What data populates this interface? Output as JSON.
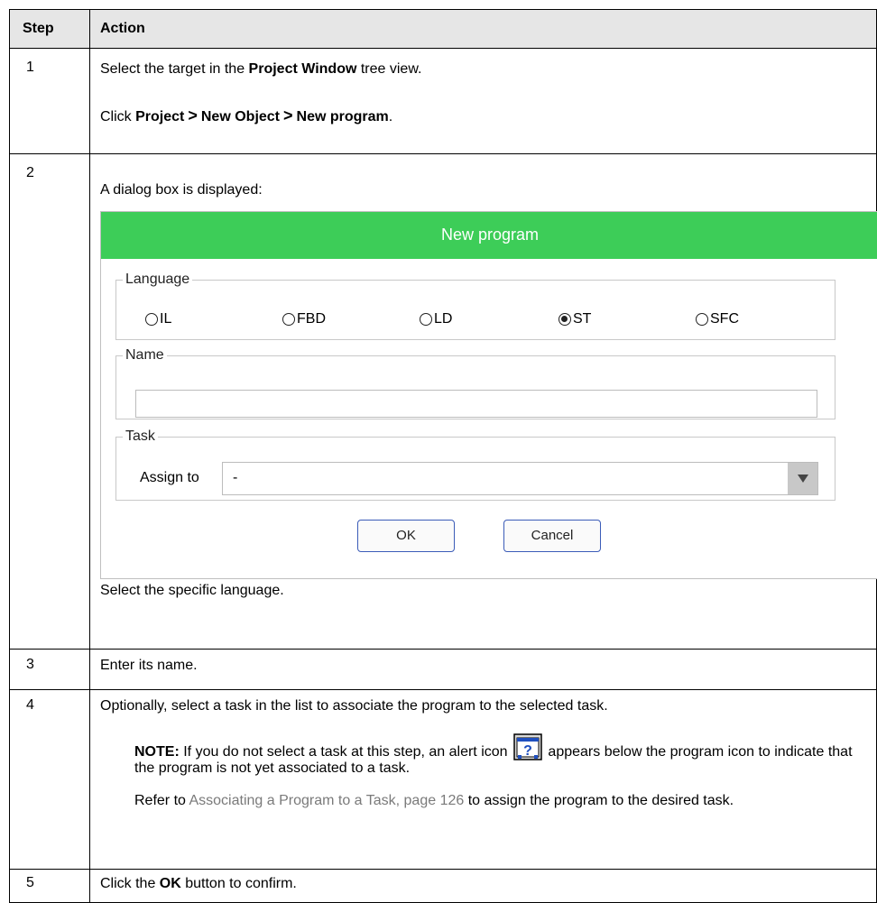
{
  "table": {
    "headers": {
      "step": "Step",
      "action": "Action"
    },
    "step1": {
      "num": "1",
      "line1_pre": "Select the target in the ",
      "line1_bold": "Project Window",
      "line1_post": " tree view.",
      "line2_pre": "Click ",
      "menu1": "Project",
      "menu2": "New Object",
      "menu3": "New program",
      "separator": ">",
      "line2_post": "."
    },
    "step2": {
      "num": "2",
      "intro": "A dialog box is displayed:",
      "outro": "Select the specific language."
    },
    "step3": {
      "num": "3",
      "text": "Enter its name."
    },
    "step4": {
      "num": "4",
      "text": "Optionally, select a task in the list to associate the program to the selected task.",
      "note_label": "NOTE:",
      "note_pre": " If you do not select a task at this step, an alert icon ",
      "note_post": " appears below the program icon to indicate that the program is not yet associated to a task.",
      "refer_pre": "Refer to ",
      "refer_link": "Associating a Program to a Task, page 126",
      "refer_post": " to assign the program to the desired task."
    },
    "step5": {
      "num": "5",
      "pre": "Click the ",
      "bold": "OK",
      "post": " button to confirm."
    }
  },
  "dialog": {
    "title": "New program",
    "title_color": "#3dcd58",
    "language_group": "Language",
    "languages": [
      "IL",
      "FBD",
      "LD",
      "ST",
      "SFC"
    ],
    "selected_language": "ST",
    "name_group": "Name",
    "name_value": "",
    "task_group": "Task",
    "assign_label": "Assign to",
    "assign_value": "-",
    "ok_label": "OK",
    "cancel_label": "Cancel"
  },
  "icons": {
    "alert": "alert-question-icon",
    "dropdown": "chevron-down-icon"
  }
}
